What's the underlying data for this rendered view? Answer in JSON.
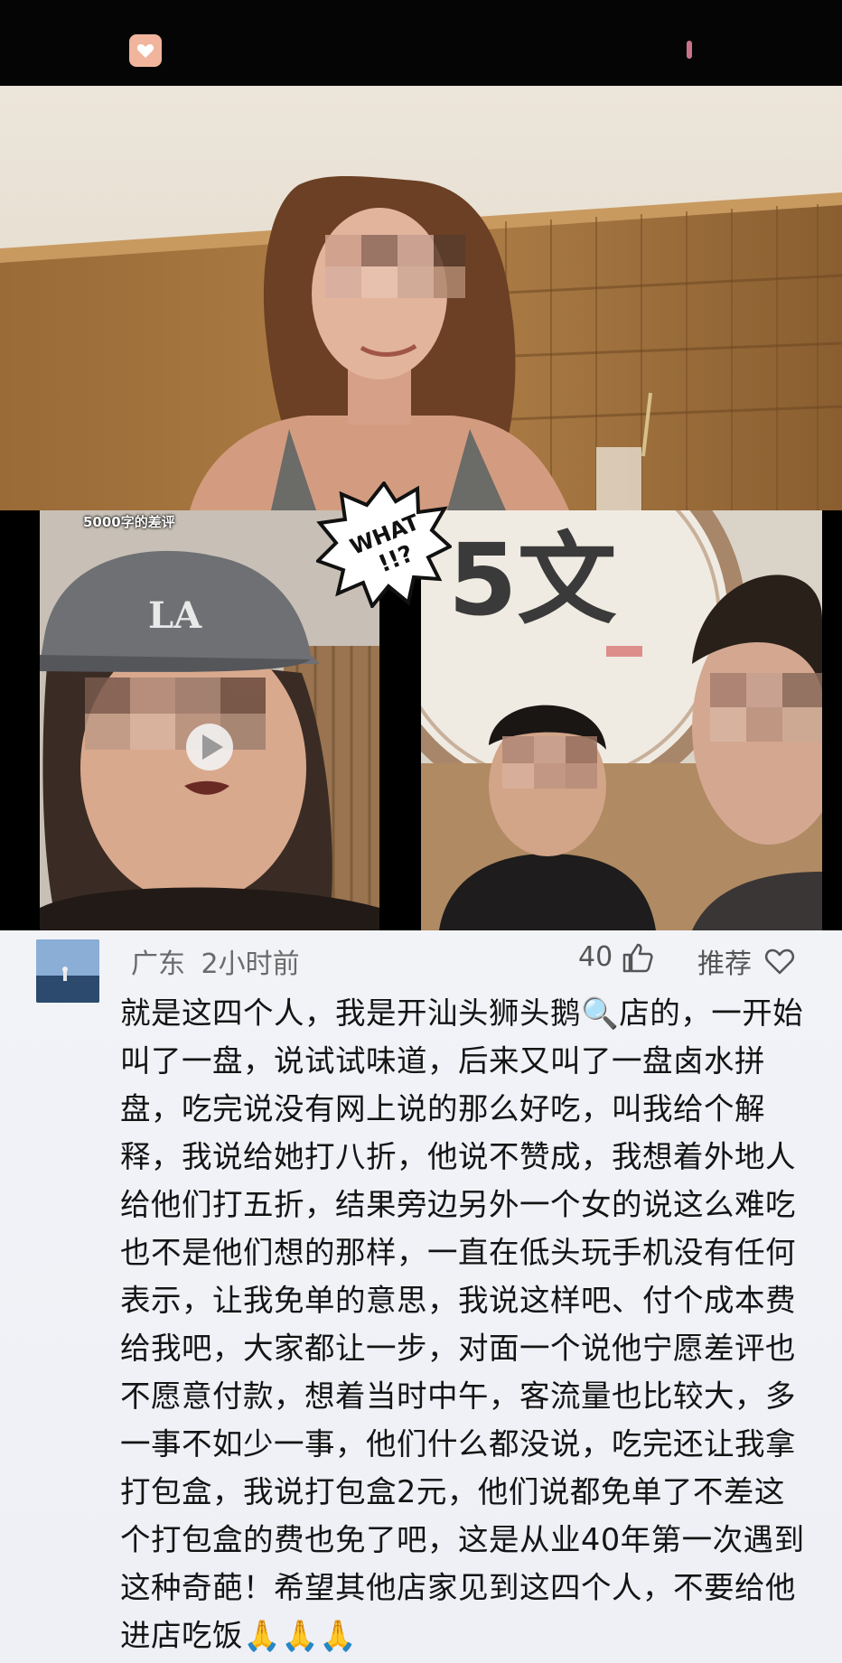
{
  "photo": {
    "caption": "5000字的差评",
    "burst_text_line1": "WHAT",
    "burst_text_line2": "!!?"
  },
  "comment": {
    "location": "广东",
    "time_ago": "2小时前",
    "like_count": "40",
    "recommend_label": "推荐",
    "text": "就是这四个人，我是开汕头狮头鹅🔍店的，一开始叫了一盘，说试试味道，后来又叫了一盘卤水拼盘，吃完说没有网上说的那么好吃，叫我给个解释，我说给她打八折，他说不赞成，我想着外地人给他们打五折，结果旁边另外一个女的说这么难吃也不是他们想的那样，一直在低头玩手机没有任何表示，让我免单的意思，我说这样吧、付个成本费给我吧，大家都让一步，对面一个说他宁愿差评也不愿意付款，想着当时中午，客流量也比较大，多一事不如少一事，他们什么都没说，吃完还让我拿打包盒，我说打包盒2元，他们说都免单了不差这个打包盒的费也免了吧，这是从业40年第一次遇到这种奇葩！希望其他店家见到这四个人，不要给他进店吃饭🙏🙏🙏"
  },
  "colors": {
    "top_bar": "#050505",
    "comment_bg": "#f1f3f7",
    "meta_text": "#6a6a6a",
    "body_text": "#141414"
  }
}
